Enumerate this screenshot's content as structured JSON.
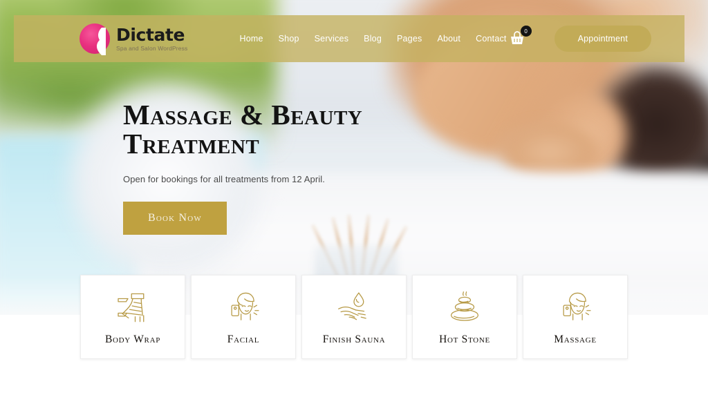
{
  "site": {
    "brand_name": "Dictate",
    "brand_tagline": "Spa and Salon WordPress",
    "logo_icon": "woman-silhouette-circle-logo",
    "accent_gold": "#bfa140",
    "header_overlay": "#c4b160",
    "logo_pink": "#e8307f"
  },
  "header": {
    "nav": [
      {
        "label": "Home"
      },
      {
        "label": "Shop"
      },
      {
        "label": "Services"
      },
      {
        "label": "Blog"
      },
      {
        "label": "Pages"
      },
      {
        "label": "About"
      },
      {
        "label": "Contact"
      }
    ],
    "cart": {
      "icon": "shopping-basket-icon",
      "count": "0"
    },
    "appointment_button": "Appointment"
  },
  "hero": {
    "title_line1": "Massage & Beauty",
    "title_line2": "Treatment",
    "subtitle": "Open for bookings for all treatments from 12 April.",
    "cta_label": "Book Now",
    "background_description": "Woman lying face down on a white massage table with reed diffuser in foreground"
  },
  "services": [
    {
      "label": "Body Wrap",
      "icon": "wrapped-leg-icon"
    },
    {
      "label": "Facial",
      "icon": "face-towel-turban-icon"
    },
    {
      "label": "Finish Sauna",
      "icon": "hand-water-drop-icon"
    },
    {
      "label": "Hot Stone",
      "icon": "stacked-stones-steam-icon"
    },
    {
      "label": "Massage",
      "icon": "face-towel-turban-icon"
    }
  ]
}
